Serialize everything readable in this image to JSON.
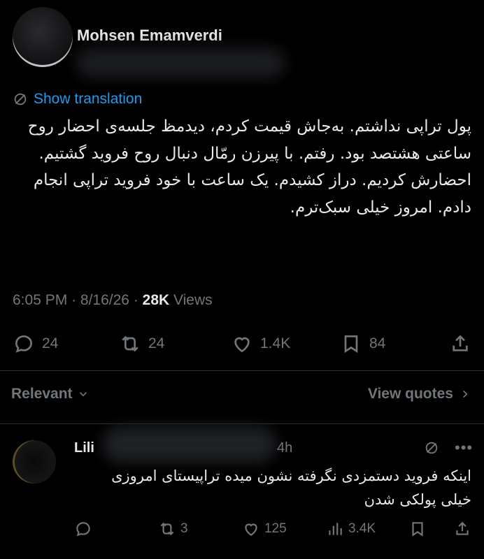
{
  "tweet": {
    "author_name": "Mohsen Emamverdi",
    "translate_label": "Show translation",
    "body": "پول تراپی نداشتم. به‌جاش قیمت کردم، دیدمظ جلسه‌ی احضار روح ساعتی هشتصد بود. رفتم. با پیرزن رمّال دنبال روح فروید گشتیم. احضارش کردیم. دراز کشیدم. یک ساعت با خود فروید تراپی انجام دادم. امروز خیلی سبک‌ترم.",
    "time": "6:05 PM",
    "date": "8/16/26",
    "views_count": "28K",
    "views_label": "Views"
  },
  "actions": {
    "replies": "24",
    "reposts": "24",
    "likes": "1.4K",
    "bookmarks": "84"
  },
  "filter": {
    "sort_label": "Relevant",
    "quotes_label": "View quotes"
  },
  "reply": {
    "author_name": "Lili",
    "time": "4h",
    "body": "اینکه فروید دستمزدی نگرفته نشون میده تراپیستای امروزی خیلی پولکی شدن",
    "reposts": "3",
    "likes": "125",
    "views": "3.4K"
  },
  "icons": [
    "globe-icon",
    "reply-icon",
    "repost-icon",
    "like-icon",
    "bookmark-icon",
    "share-icon",
    "chevron-down-icon",
    "chevron-right-icon",
    "more-icon",
    "views-icon"
  ],
  "colors": {
    "background": "#000000",
    "text": "#e7e9ea",
    "muted": "#71767b",
    "link": "#1d9bf0",
    "divider": "#2f3336"
  }
}
